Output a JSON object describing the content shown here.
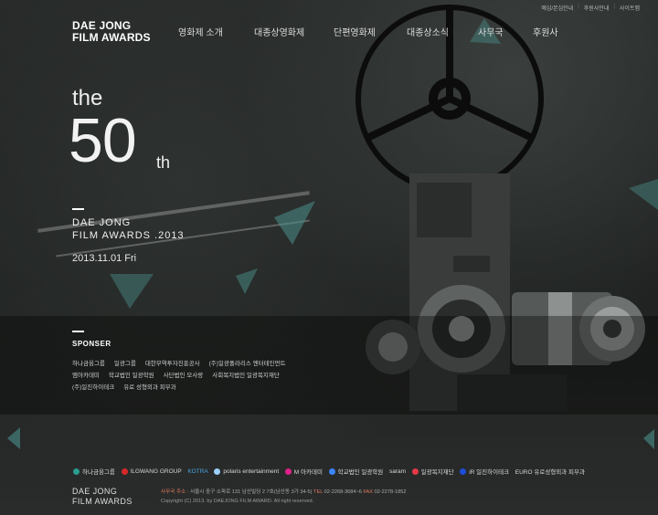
{
  "util_links": [
    "예심/본심안내",
    "후원사안내",
    "사이트맵"
  ],
  "logo": {
    "line1": "DAE JONG",
    "line2": "FILM AWARDS"
  },
  "nav": [
    "영화제 소개",
    "대종상영화제",
    "단편영화제",
    "대종상소식",
    "사무국",
    "후원사"
  ],
  "hero": {
    "the": "the",
    "number": "50",
    "suffix": "th",
    "title1": "DAE JONG",
    "title2": "FILM AWARDS .2013",
    "date": "2013.11.01 Fri"
  },
  "sponsor": {
    "heading": "SPONSER",
    "row1": [
      "하나금융그룹",
      "일광그룹",
      "대한무역투자진흥공사",
      "(주)일광폴라리스 엔터테인먼트"
    ],
    "row2": [
      "엠아카데미",
      "학교법인 일광학원",
      "사단법인 모사랑",
      "사회복지법인 일광복지재단"
    ],
    "row3": [
      "(주)일진하이테크",
      "유로 성형외과 피부과"
    ]
  },
  "logos": [
    "하나금융그룹",
    "ILGWANG GROUP",
    "KOTRA",
    "polaris entertainment",
    "M 아카데미",
    "학교법인 일광학원",
    "saram",
    "일광복지재단",
    "iR 일진하이테크",
    "EURO 유로성형외과 피부과"
  ],
  "footer": {
    "logo1": "DAE JONG",
    "logo2": "FILM AWARDS",
    "addr_label": "사무국 주소 :",
    "addr": "서울시 중구 소파로 131 남산빌딩 2 7호(남산동 3가 34-5)",
    "tel_label": "TEL",
    "tel": "02-2268-3684~6",
    "fax_label": "FAX",
    "fax": "02-2278-1852",
    "copyright": "Copyright (C) 2013. by DAEJONG FILM AWARD. All right reserved."
  }
}
